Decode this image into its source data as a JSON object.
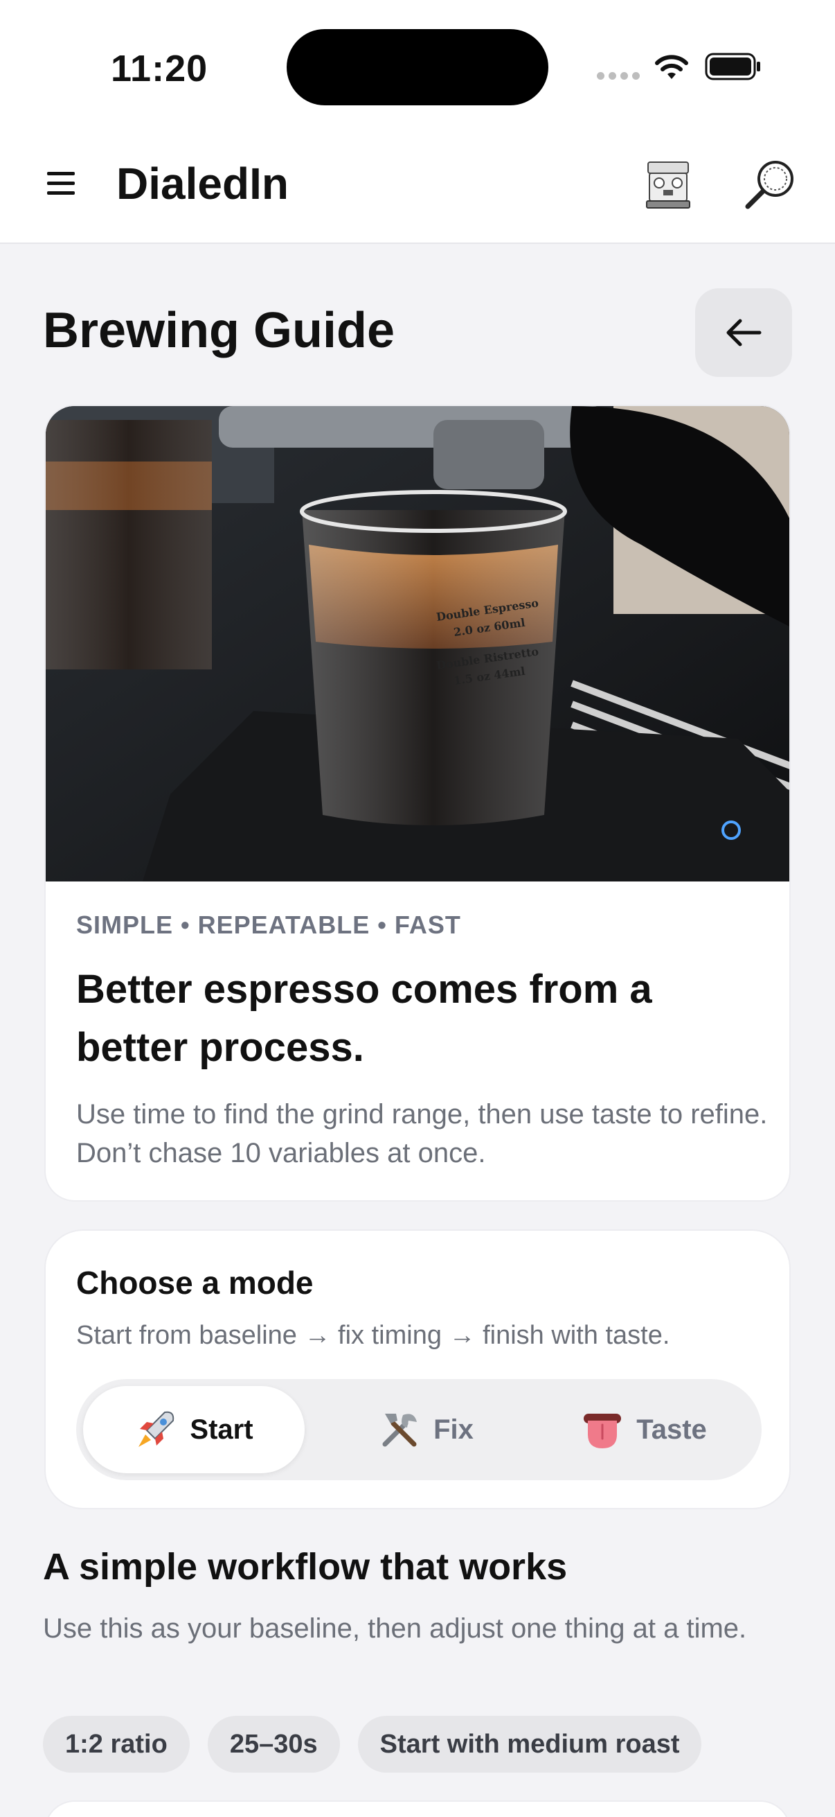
{
  "status_bar": {
    "time": "11:20"
  },
  "app": {
    "title": "DialedIn"
  },
  "page": {
    "title": "Brewing Guide"
  },
  "hero": {
    "kicker": "SIMPLE • REPEATABLE • FAST",
    "heading": "Better espresso comes from a better process.",
    "body": "Use time to find the grind range, then use taste to refine. Don’t chase 10 variables at once.",
    "glass_label_1": "Double Espresso",
    "glass_label_2": "2.0 oz 60ml",
    "glass_label_3": "Double Ristretto",
    "glass_label_4": "1.5 oz 44ml"
  },
  "mode": {
    "title": "Choose a mode",
    "subtitle": "Start from baseline → fix timing → finish with taste.",
    "options": [
      {
        "label": "Start",
        "icon": "rocket-icon",
        "active": true
      },
      {
        "label": "Fix",
        "icon": "tools-icon",
        "active": false
      },
      {
        "label": "Taste",
        "icon": "tongue-icon",
        "active": false
      }
    ]
  },
  "workflow": {
    "title": "A simple workflow that works",
    "body": "Use this as your baseline, then adjust one thing at a time.",
    "chips": [
      "1:2 ratio",
      "25–30s",
      "Start with medium roast"
    ]
  },
  "colors": {
    "background": "#f3f3f6",
    "card": "#ffffff",
    "muted_text": "#6b6f78",
    "chip_bg": "#e6e6e9"
  }
}
